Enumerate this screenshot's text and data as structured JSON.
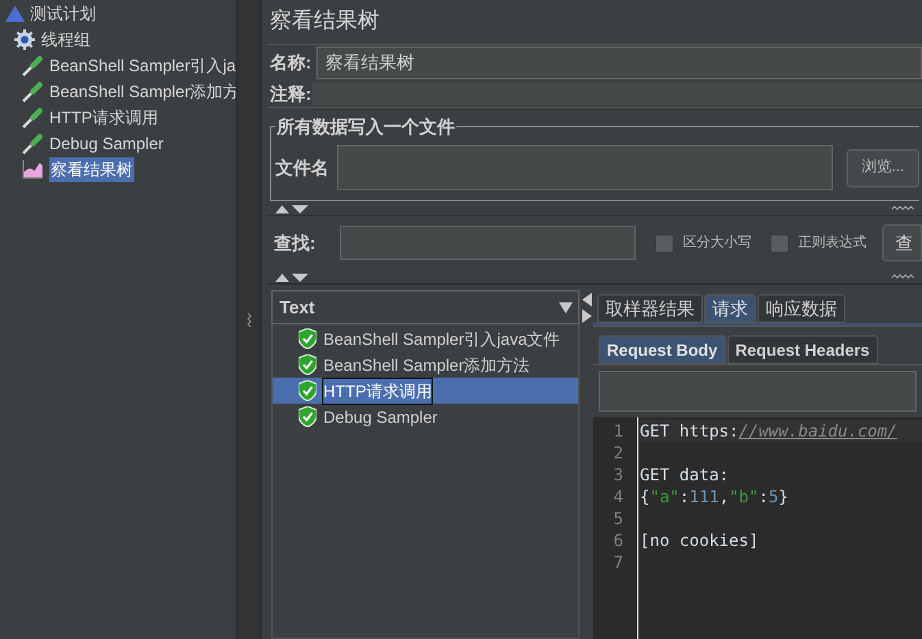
{
  "tree": [
    {
      "label": "测试计划",
      "kind": "plan",
      "selected": false,
      "children": [
        {
          "label": "线程组",
          "kind": "group",
          "selected": false,
          "children": [
            {
              "label": "BeanShell Sampler引入ja",
              "kind": "sampler",
              "selected": false
            },
            {
              "label": "BeanShell Sampler添加方",
              "kind": "sampler",
              "selected": false
            },
            {
              "label": "HTTP请求调用",
              "kind": "sampler",
              "selected": false
            },
            {
              "label": "Debug Sampler",
              "kind": "sampler",
              "selected": false
            },
            {
              "label": "察看结果树",
              "kind": "listener",
              "selected": true
            }
          ]
        }
      ]
    }
  ],
  "panel": {
    "title": "察看结果树",
    "name_label": "名称:",
    "name_value": "察看结果树",
    "comment_label": "注释:",
    "file_group": {
      "legend": "所有数据写入一个文件",
      "file_label": "文件名",
      "browse": "浏览..."
    },
    "search": {
      "label": "查找:",
      "options": [
        {
          "label": "区分大小写",
          "checked": false
        },
        {
          "label": "正则表达式",
          "checked": false
        }
      ],
      "button": "查"
    }
  },
  "results": {
    "renderer": "Text",
    "samples": [
      {
        "label": "BeanShell Sampler引入java文件",
        "selected": false
      },
      {
        "label": "BeanShell Sampler添加方法",
        "selected": false
      },
      {
        "label": "HTTP请求调用",
        "selected": true
      },
      {
        "label": "Debug Sampler",
        "selected": false
      }
    ],
    "tabs": [
      {
        "label": "取样器结果",
        "selected": false
      },
      {
        "label": "请求",
        "selected": true
      },
      {
        "label": "响应数据",
        "selected": false
      }
    ],
    "subtabs": [
      {
        "label": "Request Body",
        "selected": true
      },
      {
        "label": "Request Headers",
        "selected": false
      }
    ],
    "lines": [
      {
        "number": "1",
        "tokens": [
          {
            "kind": "plain",
            "text": "GET https:"
          },
          {
            "kind": "url",
            "text": "//www.baidu.com/"
          }
        ]
      },
      {
        "number": "2"
      },
      {
        "number": "3",
        "tokens": [
          {
            "kind": "plain",
            "text": "GET data:"
          }
        ]
      },
      {
        "number": "4",
        "tokens": [
          {
            "kind": "plain",
            "text": "{"
          },
          {
            "kind": "string",
            "text": "\"a\""
          },
          {
            "kind": "plain",
            "text": ":"
          },
          {
            "kind": "number",
            "text": "111"
          },
          {
            "kind": "plain",
            "text": ","
          },
          {
            "kind": "string",
            "text": "\"b\""
          },
          {
            "kind": "plain",
            "text": ":"
          },
          {
            "kind": "number",
            "text": "5"
          },
          {
            "kind": "plain",
            "text": "}"
          }
        ]
      },
      {
        "number": "5"
      },
      {
        "number": "6",
        "tokens": [
          {
            "kind": "plain",
            "text": "[no cookies]"
          }
        ]
      },
      {
        "number": "7"
      }
    ]
  }
}
